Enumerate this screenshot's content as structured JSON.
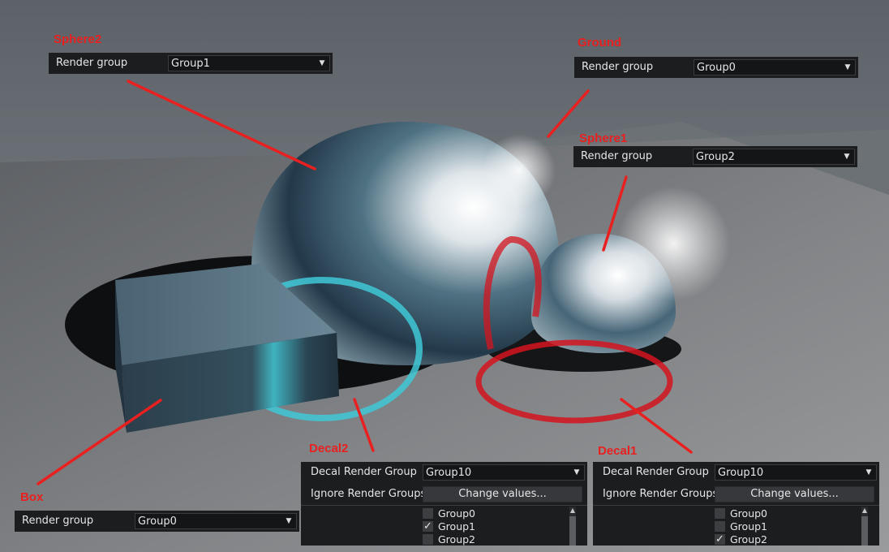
{
  "labels": {
    "sphere2": "Sphere2",
    "ground": "Ground",
    "sphere1": "Sphere1",
    "box": "Box",
    "decal2": "Decal2",
    "decal1": "Decal1"
  },
  "sphere2_panel": {
    "label": "Render group",
    "value": "Group1"
  },
  "ground_panel": {
    "label": "Render group",
    "value": "Group0"
  },
  "sphere1_panel": {
    "label": "Render group",
    "value": "Group2"
  },
  "box_panel": {
    "label": "Render group",
    "value": "Group0"
  },
  "decal2_panel": {
    "decal_label": "Decal Render Group",
    "decal_value": "Group10",
    "ignore_label": "Ignore Render Groups",
    "button_label": "Change values...",
    "groups": [
      {
        "name": "Group0",
        "checked": false
      },
      {
        "name": "Group1",
        "checked": true
      },
      {
        "name": "Group2",
        "checked": false
      }
    ]
  },
  "decal1_panel": {
    "decal_label": "Decal Render Group",
    "decal_value": "Group10",
    "ignore_label": "Ignore Render Groups",
    "button_label": "Change values...",
    "groups": [
      {
        "name": "Group0",
        "checked": false
      },
      {
        "name": "Group1",
        "checked": false
      },
      {
        "name": "Group2",
        "checked": true
      }
    ]
  },
  "icons": {
    "dropdown": "chevron-down-icon",
    "check": "checkmark-icon",
    "scroll_up": "scroll-up-arrow-icon"
  },
  "colors": {
    "callout": "#e8201f",
    "decal_cyan": "#3fc8d6",
    "decal_red": "#d4141e",
    "panel_bg": "#1c1d1f"
  }
}
